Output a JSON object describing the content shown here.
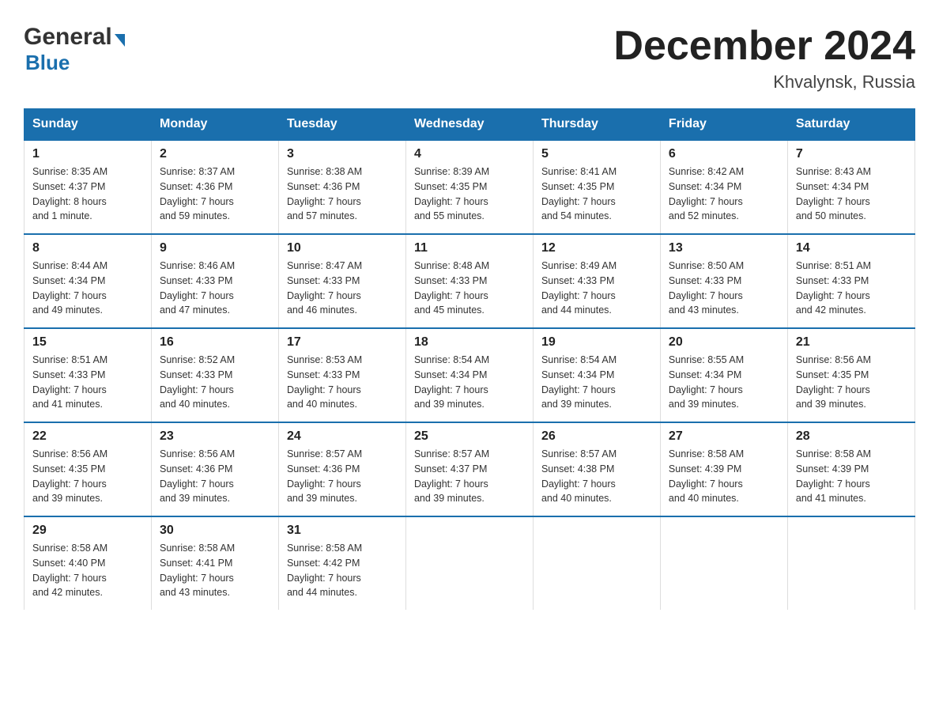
{
  "logo": {
    "general": "General",
    "blue": "Blue",
    "arrow": "▶"
  },
  "title": "December 2024",
  "location": "Khvalynsk, Russia",
  "days_of_week": [
    "Sunday",
    "Monday",
    "Tuesday",
    "Wednesday",
    "Thursday",
    "Friday",
    "Saturday"
  ],
  "weeks": [
    [
      {
        "day": "1",
        "sunrise": "8:35 AM",
        "sunset": "4:37 PM",
        "daylight": "8 hours and 1 minute."
      },
      {
        "day": "2",
        "sunrise": "8:37 AM",
        "sunset": "4:36 PM",
        "daylight": "7 hours and 59 minutes."
      },
      {
        "day": "3",
        "sunrise": "8:38 AM",
        "sunset": "4:36 PM",
        "daylight": "7 hours and 57 minutes."
      },
      {
        "day": "4",
        "sunrise": "8:39 AM",
        "sunset": "4:35 PM",
        "daylight": "7 hours and 55 minutes."
      },
      {
        "day": "5",
        "sunrise": "8:41 AM",
        "sunset": "4:35 PM",
        "daylight": "7 hours and 54 minutes."
      },
      {
        "day": "6",
        "sunrise": "8:42 AM",
        "sunset": "4:34 PM",
        "daylight": "7 hours and 52 minutes."
      },
      {
        "day": "7",
        "sunrise": "8:43 AM",
        "sunset": "4:34 PM",
        "daylight": "7 hours and 50 minutes."
      }
    ],
    [
      {
        "day": "8",
        "sunrise": "8:44 AM",
        "sunset": "4:34 PM",
        "daylight": "7 hours and 49 minutes."
      },
      {
        "day": "9",
        "sunrise": "8:46 AM",
        "sunset": "4:33 PM",
        "daylight": "7 hours and 47 minutes."
      },
      {
        "day": "10",
        "sunrise": "8:47 AM",
        "sunset": "4:33 PM",
        "daylight": "7 hours and 46 minutes."
      },
      {
        "day": "11",
        "sunrise": "8:48 AM",
        "sunset": "4:33 PM",
        "daylight": "7 hours and 45 minutes."
      },
      {
        "day": "12",
        "sunrise": "8:49 AM",
        "sunset": "4:33 PM",
        "daylight": "7 hours and 44 minutes."
      },
      {
        "day": "13",
        "sunrise": "8:50 AM",
        "sunset": "4:33 PM",
        "daylight": "7 hours and 43 minutes."
      },
      {
        "day": "14",
        "sunrise": "8:51 AM",
        "sunset": "4:33 PM",
        "daylight": "7 hours and 42 minutes."
      }
    ],
    [
      {
        "day": "15",
        "sunrise": "8:51 AM",
        "sunset": "4:33 PM",
        "daylight": "7 hours and 41 minutes."
      },
      {
        "day": "16",
        "sunrise": "8:52 AM",
        "sunset": "4:33 PM",
        "daylight": "7 hours and 40 minutes."
      },
      {
        "day": "17",
        "sunrise": "8:53 AM",
        "sunset": "4:33 PM",
        "daylight": "7 hours and 40 minutes."
      },
      {
        "day": "18",
        "sunrise": "8:54 AM",
        "sunset": "4:34 PM",
        "daylight": "7 hours and 39 minutes."
      },
      {
        "day": "19",
        "sunrise": "8:54 AM",
        "sunset": "4:34 PM",
        "daylight": "7 hours and 39 minutes."
      },
      {
        "day": "20",
        "sunrise": "8:55 AM",
        "sunset": "4:34 PM",
        "daylight": "7 hours and 39 minutes."
      },
      {
        "day": "21",
        "sunrise": "8:56 AM",
        "sunset": "4:35 PM",
        "daylight": "7 hours and 39 minutes."
      }
    ],
    [
      {
        "day": "22",
        "sunrise": "8:56 AM",
        "sunset": "4:35 PM",
        "daylight": "7 hours and 39 minutes."
      },
      {
        "day": "23",
        "sunrise": "8:56 AM",
        "sunset": "4:36 PM",
        "daylight": "7 hours and 39 minutes."
      },
      {
        "day": "24",
        "sunrise": "8:57 AM",
        "sunset": "4:36 PM",
        "daylight": "7 hours and 39 minutes."
      },
      {
        "day": "25",
        "sunrise": "8:57 AM",
        "sunset": "4:37 PM",
        "daylight": "7 hours and 39 minutes."
      },
      {
        "day": "26",
        "sunrise": "8:57 AM",
        "sunset": "4:38 PM",
        "daylight": "7 hours and 40 minutes."
      },
      {
        "day": "27",
        "sunrise": "8:58 AM",
        "sunset": "4:39 PM",
        "daylight": "7 hours and 40 minutes."
      },
      {
        "day": "28",
        "sunrise": "8:58 AM",
        "sunset": "4:39 PM",
        "daylight": "7 hours and 41 minutes."
      }
    ],
    [
      {
        "day": "29",
        "sunrise": "8:58 AM",
        "sunset": "4:40 PM",
        "daylight": "7 hours and 42 minutes."
      },
      {
        "day": "30",
        "sunrise": "8:58 AM",
        "sunset": "4:41 PM",
        "daylight": "7 hours and 43 minutes."
      },
      {
        "day": "31",
        "sunrise": "8:58 AM",
        "sunset": "4:42 PM",
        "daylight": "7 hours and 44 minutes."
      },
      null,
      null,
      null,
      null
    ]
  ]
}
